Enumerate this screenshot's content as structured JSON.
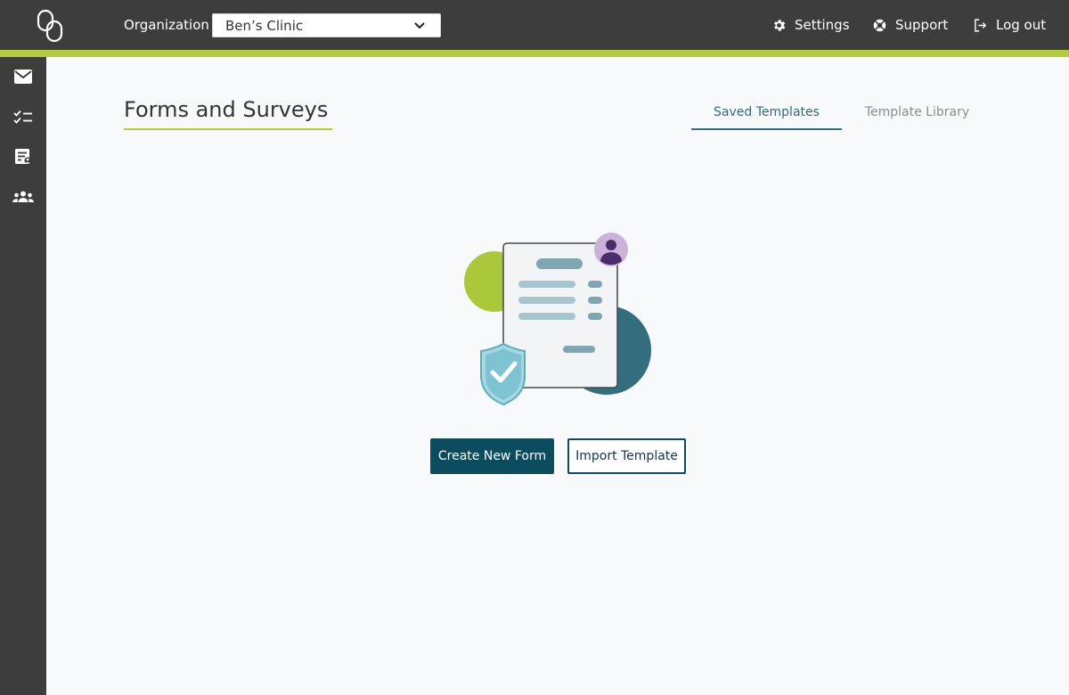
{
  "header": {
    "organization_label": "Organization",
    "organization_value": "Ben’s Clinic",
    "links": {
      "settings": "Settings",
      "support": "Support",
      "logout": "Log out"
    }
  },
  "sidebar": {
    "items": [
      {
        "icon": "mail-icon"
      },
      {
        "icon": "checklist-icon"
      },
      {
        "icon": "form-user-icon"
      },
      {
        "icon": "group-icon"
      }
    ]
  },
  "main": {
    "title": "Forms and Surveys",
    "tabs": [
      {
        "label": "Saved Templates",
        "active": true
      },
      {
        "label": "Template Library",
        "active": false
      }
    ],
    "actions": {
      "create": "Create New Form",
      "import": "Import Template"
    }
  },
  "colors": {
    "topbar": "#3d3d3d",
    "accent_green": "#b4cb3b",
    "primary_teal": "#0b4d5f",
    "tab_active": "#2e6b7d",
    "background": "#f8f9fa"
  }
}
